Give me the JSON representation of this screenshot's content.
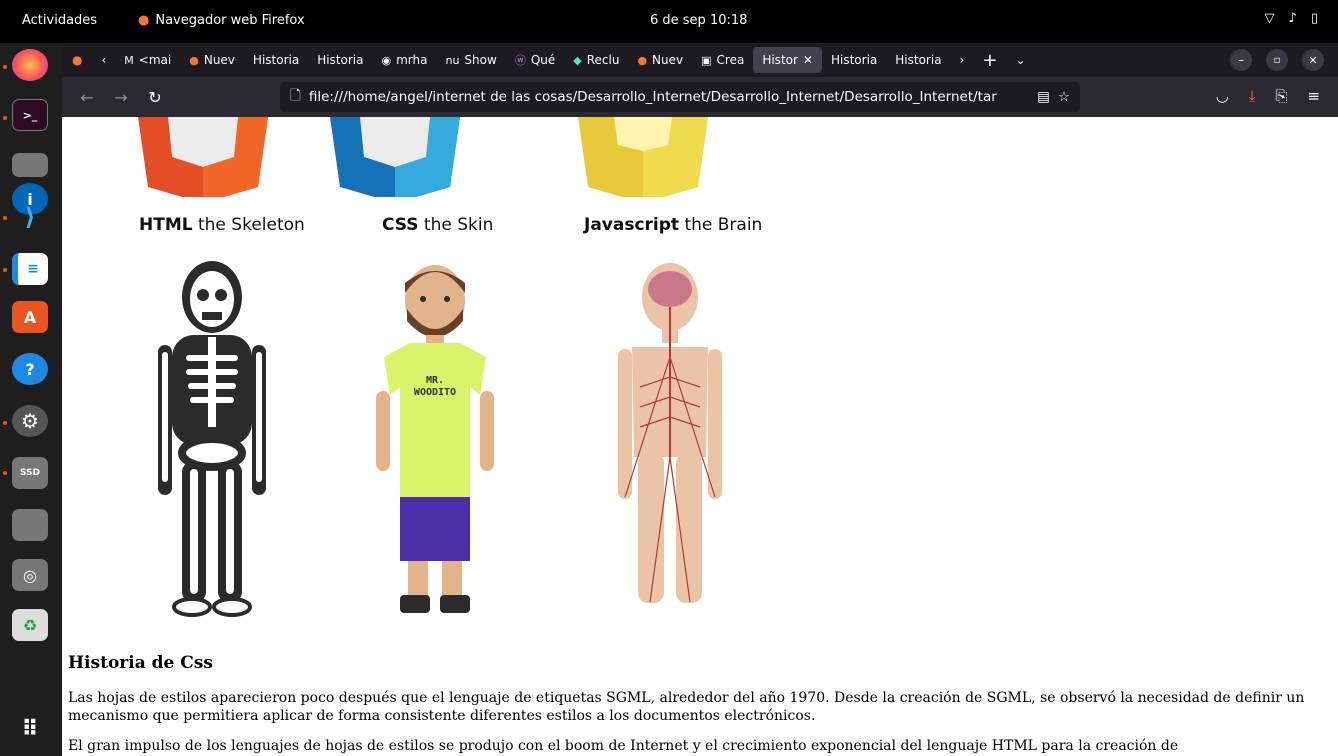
{
  "topbar": {
    "activities": "Actividades",
    "app_name": "Navegador web Firefox",
    "clock": "6 de sep  10:18"
  },
  "dock": {
    "items": [
      {
        "icon": "firefox-icon"
      },
      {
        "icon": "terminal-icon"
      },
      {
        "icon": "files-icon"
      },
      {
        "icon": "vscode-icon"
      },
      {
        "icon": "libreoffice-writer-icon"
      },
      {
        "icon": "app-center-icon"
      },
      {
        "icon": "help-icon"
      },
      {
        "icon": "settings-icon"
      },
      {
        "icon": "ssd-drive-icon"
      },
      {
        "icon": "disk-icon"
      },
      {
        "icon": "optical-drive-icon"
      },
      {
        "icon": "trash-icon"
      },
      {
        "icon": "show-apps-icon"
      }
    ]
  },
  "tabs": [
    {
      "label": "",
      "icon": "firefox-icon"
    },
    {
      "label": "<mai",
      "icon": "gmail-icon"
    },
    {
      "label": "Nuev",
      "icon": "firefox-icon"
    },
    {
      "label": "Historia",
      "icon": ""
    },
    {
      "label": "Historia",
      "icon": ""
    },
    {
      "label": "mrha",
      "icon": "github-icon"
    },
    {
      "label": "Show",
      "icon": "nu-icon"
    },
    {
      "label": "Qué",
      "icon": "w-icon"
    },
    {
      "label": "Reclu",
      "icon": "recruit-icon"
    },
    {
      "label": "Nuev",
      "icon": "firefox-icon"
    },
    {
      "label": "Crea",
      "icon": "doc-icon"
    },
    {
      "label": "Histor",
      "icon": "",
      "active": true
    },
    {
      "label": "Historia",
      "icon": ""
    },
    {
      "label": "Historia",
      "icon": ""
    }
  ],
  "url": "file:///home/angel/internet de las cosas/Desarrollo_Internet/Desarrollo_Internet/Desarrollo_Internet/tar",
  "page": {
    "captions": [
      {
        "bold": "HTML",
        "rest": " the Skeleton"
      },
      {
        "bold": "CSS",
        "rest": " the Skin"
      },
      {
        "bold": "Javascript",
        "rest": " the Brain"
      }
    ],
    "shirt_text_line1": "MR.",
    "shirt_text_line2": "WOODITO",
    "section_title": "Historia de Css",
    "paragraph1": "Las hojas de estilos aparecieron poco después que el lenguaje de etiquetas SGML, alrededor del año 1970. Desde la creación de SGML, se observó la necesidad de definir un mecanismo que permitiera aplicar de forma consistente diferentes estilos a los documentos electrónicos.",
    "paragraph2": "El gran impulso de los lenguajes de hojas de estilos se produjo con el boom de Internet y el crecimiento exponencial del lenguaje HTML para la creación de"
  },
  "colors": {
    "html_orange": "#e44d26",
    "css_blue": "#1572b6",
    "js_yellow": "#f0db4f",
    "ubuntu_orange": "#e95420"
  }
}
